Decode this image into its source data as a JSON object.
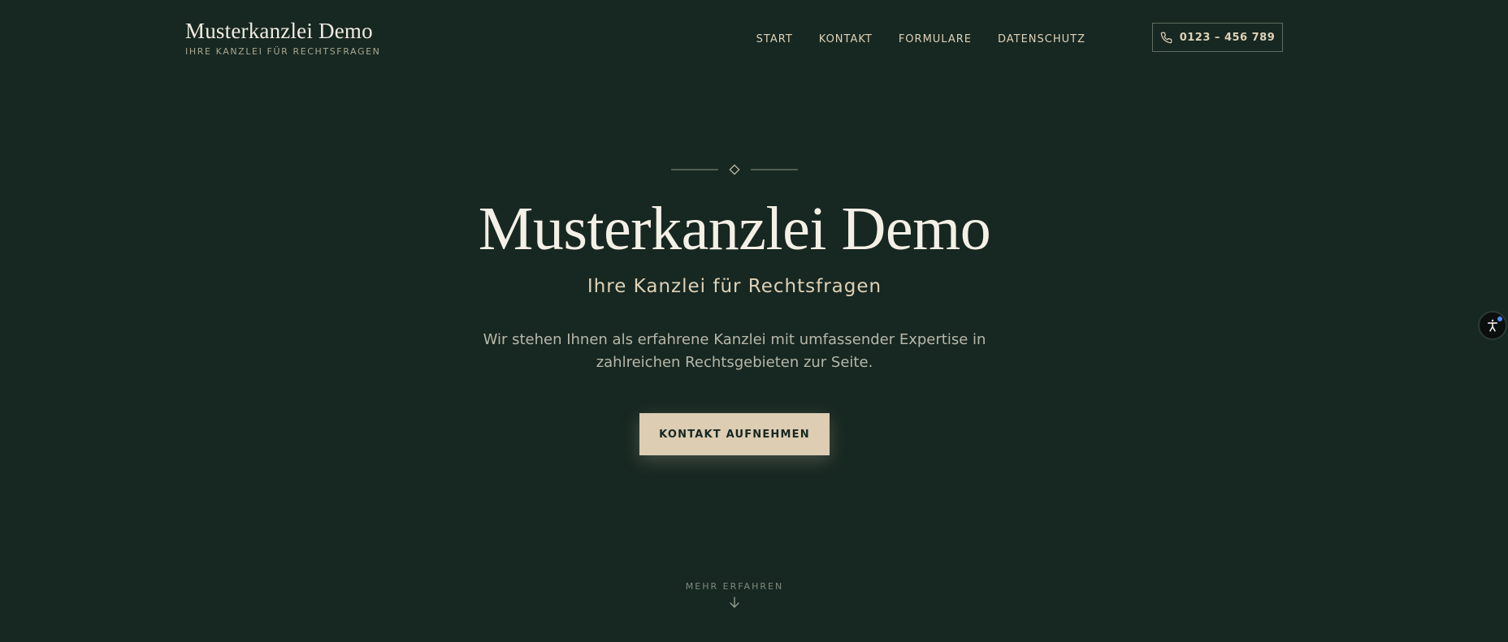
{
  "header": {
    "brand_title": "Musterkanzlei Demo",
    "brand_tagline": "IHRE KANZLEI FÜR RECHTSFRAGEN",
    "nav": [
      {
        "label": "START"
      },
      {
        "label": "KONTAKT"
      },
      {
        "label": "FORMULARE"
      },
      {
        "label": "DATENSCHUTZ"
      }
    ],
    "phone": {
      "label": "0123 – 456 789",
      "icon": "phone-icon"
    }
  },
  "hero": {
    "title": "Musterkanzlei Demo",
    "subtitle": "Ihre Kanzlei für Rechtsfragen",
    "description": "Wir stehen Ihnen als erfahrene Kanzlei mit umfassender Expertise in zahlreichen Rechtsgebieten zur Seite.",
    "cta_label": "KONTAKT AUFNEHMEN",
    "scroll_label": "MEHR ERFAHREN",
    "scroll_icon": "arrow-down-icon"
  },
  "accessibility": {
    "icon": "accessibility-icon"
  },
  "colors": {
    "background": "#172721",
    "accent": "#dccdb3",
    "heading": "#f4f0e6",
    "nav_text": "#ddd2b8"
  }
}
